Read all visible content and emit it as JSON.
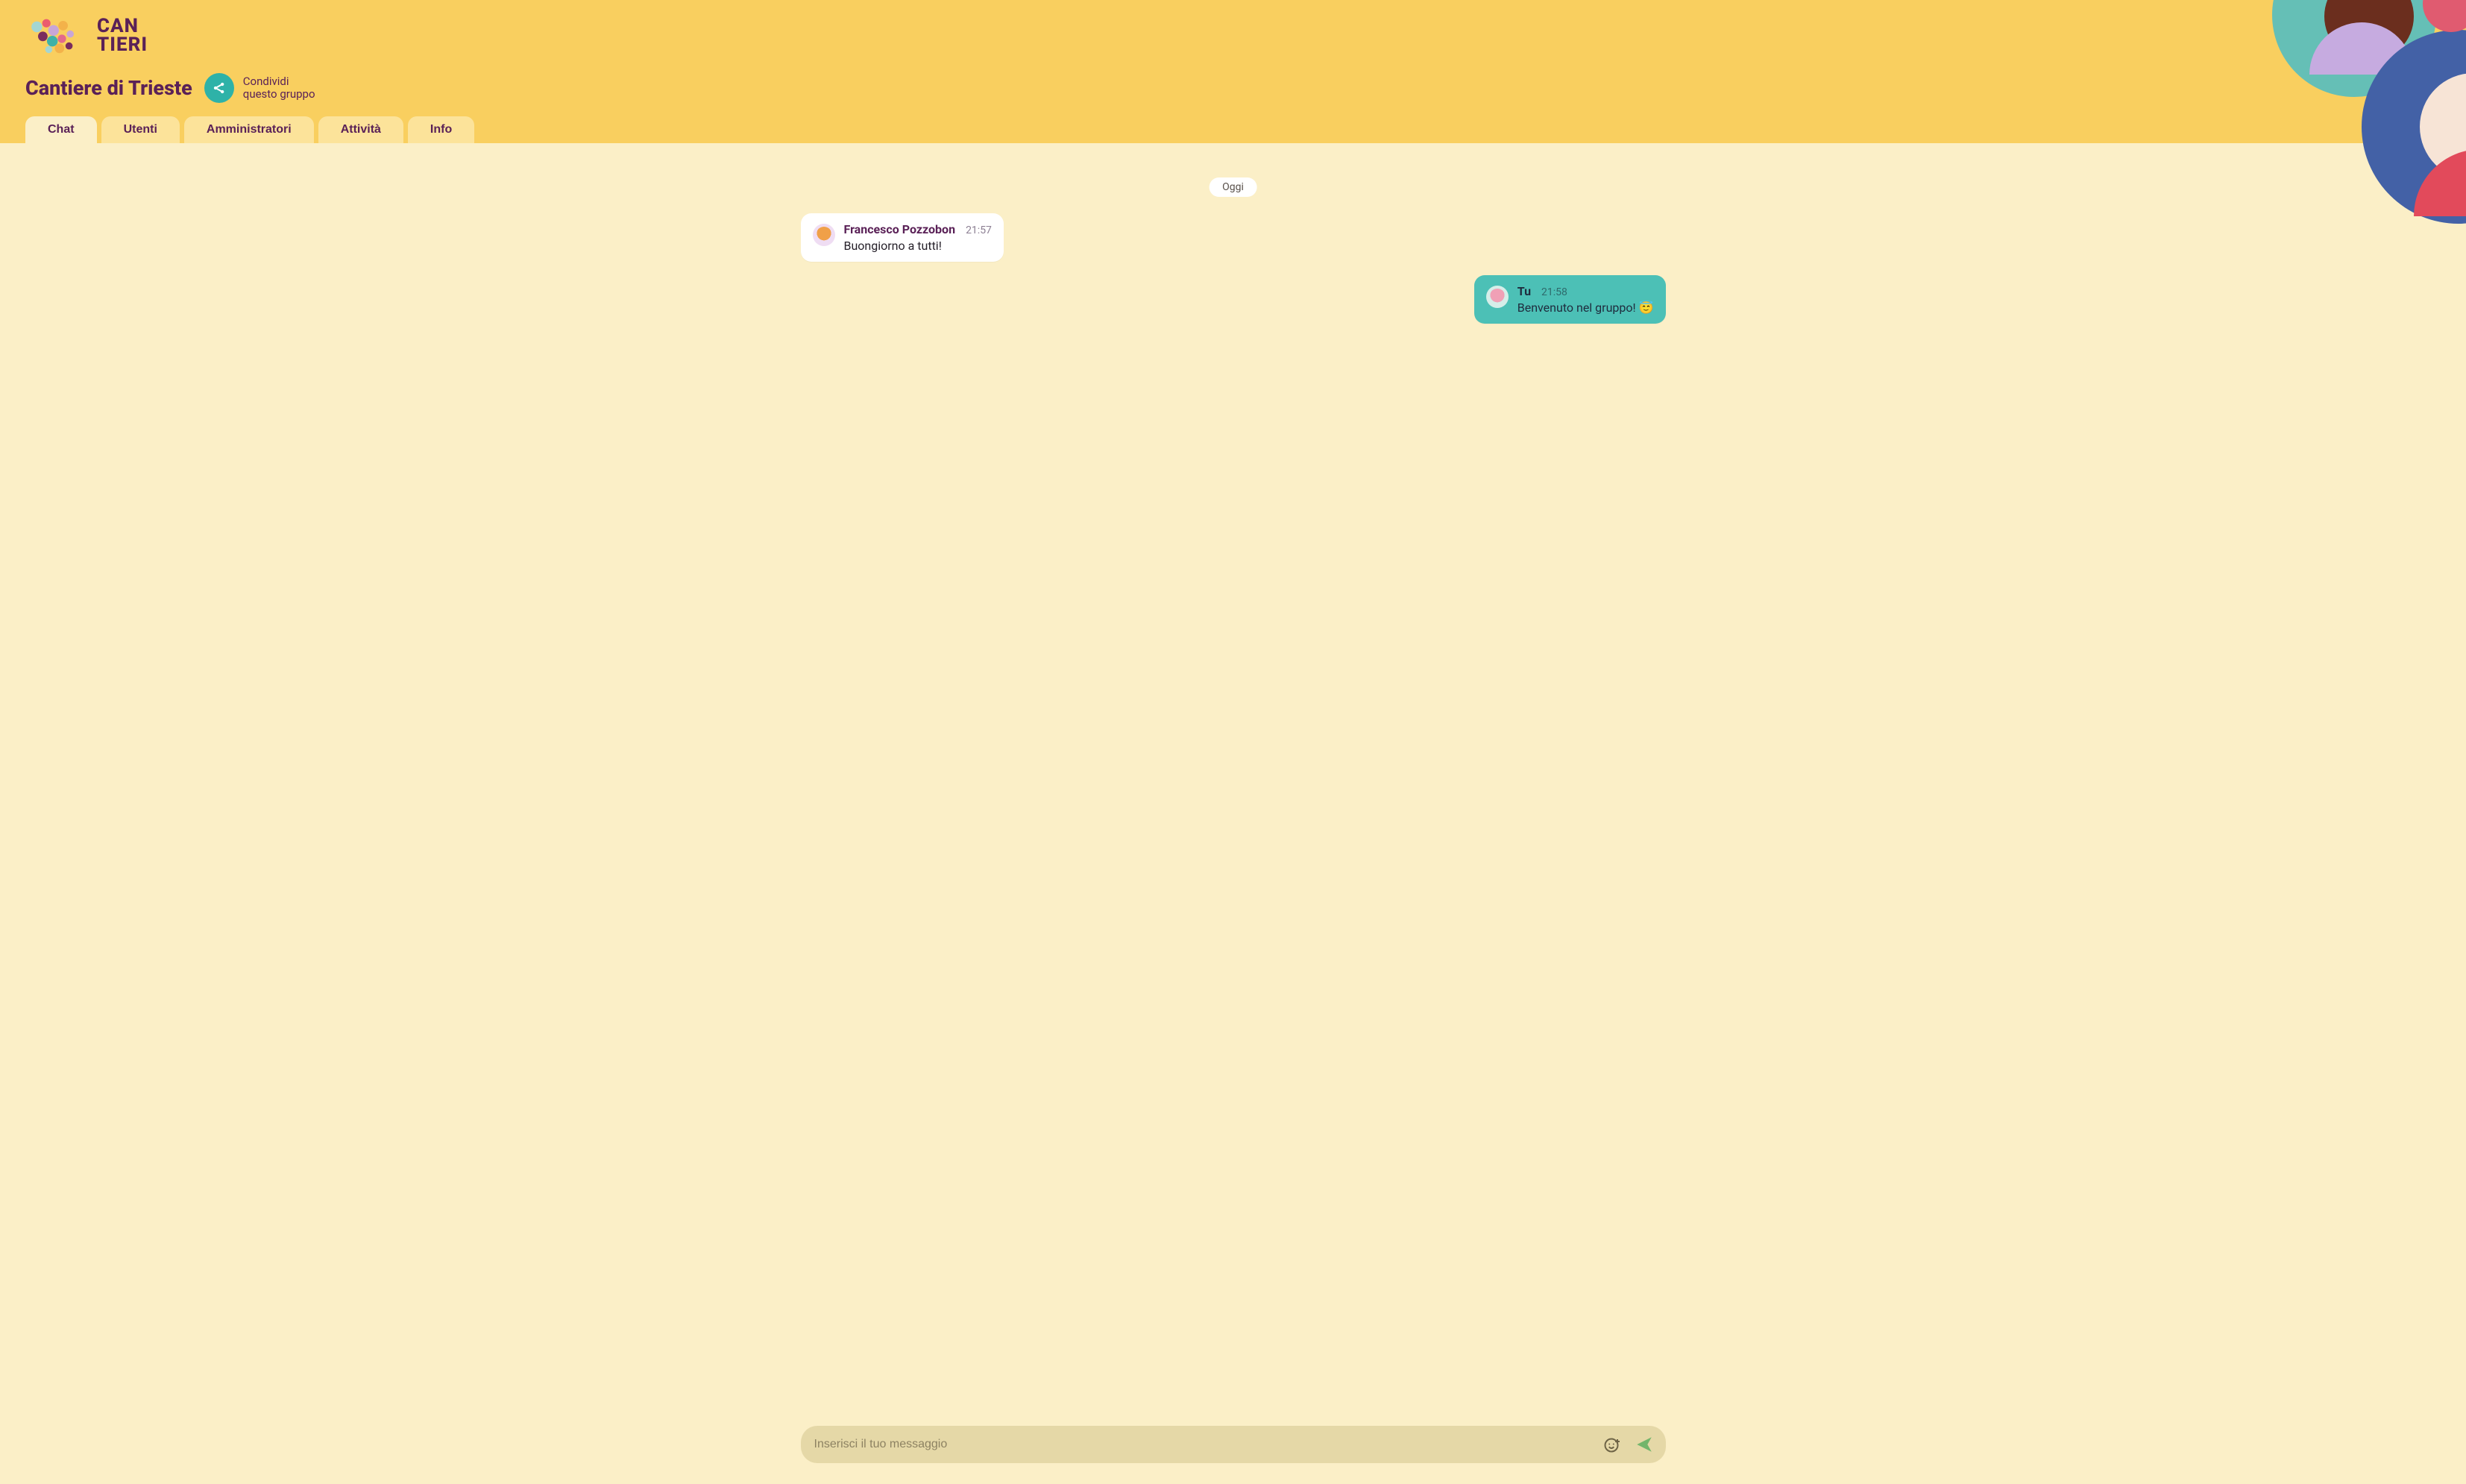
{
  "brand": {
    "line1": "CAN",
    "line2": "TIERI"
  },
  "page_title": "Cantiere di Trieste",
  "share": {
    "line1": "Condividi",
    "line2": "questo gruppo"
  },
  "tabs": [
    {
      "label": "Chat",
      "active": true
    },
    {
      "label": "Utenti",
      "active": false
    },
    {
      "label": "Amministratori",
      "active": false
    },
    {
      "label": "Attività",
      "active": false
    },
    {
      "label": "Info",
      "active": false
    }
  ],
  "chat": {
    "date_label": "Oggi",
    "messages": [
      {
        "side": "left",
        "author": "Francesco Pozzobon",
        "time": "21:57",
        "text": "Buongiorno a tutti!",
        "avatar": "a1",
        "bubble": "white"
      },
      {
        "side": "right",
        "author": "Tu",
        "time": "21:58",
        "text": "Benvenuto nel gruppo! 😇",
        "avatar": "a2",
        "bubble": "teal"
      }
    ],
    "composer_placeholder": "Inserisci il tuo messaggio"
  },
  "colors": {
    "header": "#F9CF5F",
    "body": "#FBEFC7",
    "accent": "#5A2157",
    "teal": "#4CC0B6"
  }
}
